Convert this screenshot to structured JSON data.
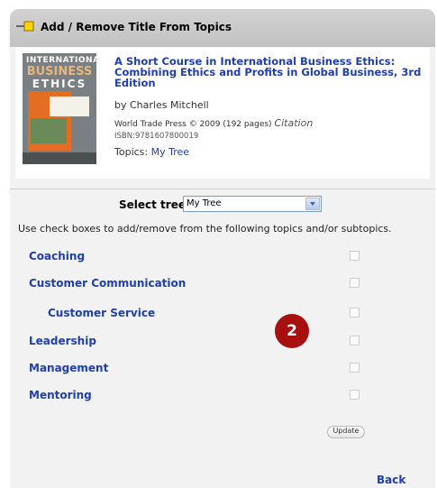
{
  "dialog": {
    "title": "Add / Remove Title From Topics"
  },
  "book": {
    "title": "A Short Course in International Business Ethics: Combining Ethics and Profits in Global Business, 3rd Edition",
    "author": "by Charles Mitchell",
    "publisher": "World Trade Press © 2009 (192 pages)",
    "citation": "Citation",
    "isbn": "ISBN:9781607800019",
    "topics_label": "Topics:",
    "topics_value": "My Tree",
    "cover": {
      "line1": "INTERNATIONAL",
      "line2": "BUSINESS",
      "line3": "ETHICS"
    }
  },
  "select_tree": {
    "label": "Select tree:",
    "value": "My Tree"
  },
  "instructions": "Use check boxes to add/remove from the following topics and/or subtopics.",
  "topics": [
    {
      "label": "Coaching",
      "checked": false
    },
    {
      "label": "Customer Communication",
      "checked": false
    },
    {
      "label": "Customer Service",
      "checked": false
    },
    {
      "label": "Leadership",
      "checked": false
    },
    {
      "label": "Management",
      "checked": false
    },
    {
      "label": "Mentoring",
      "checked": false
    }
  ],
  "badge": "2",
  "update_label": "Update",
  "back_label": "Back",
  "colors": {
    "link": "#1f3fae",
    "header_bg": "#c8c8c8",
    "badge": "#a80f0f"
  }
}
